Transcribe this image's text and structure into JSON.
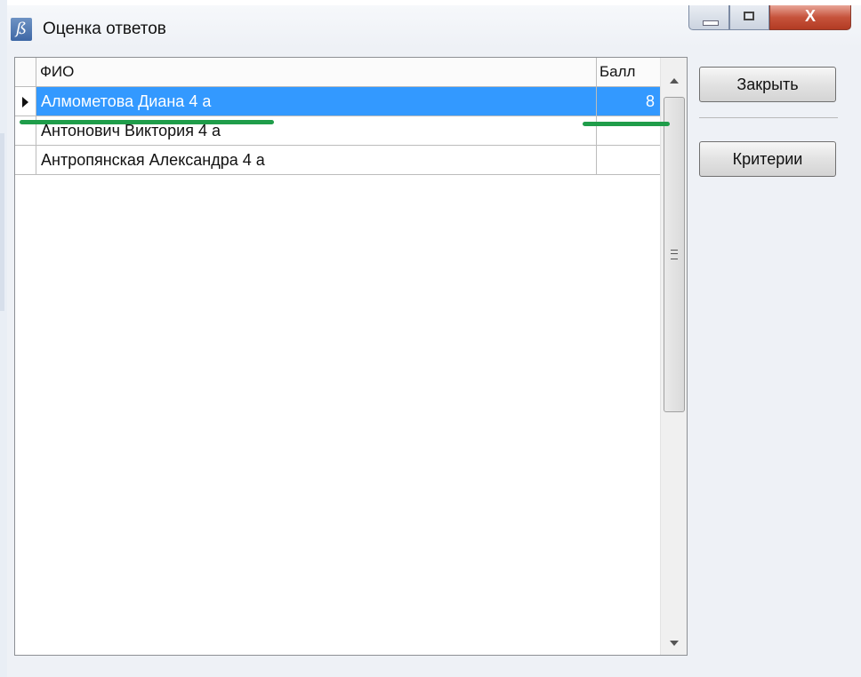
{
  "window": {
    "title": "Оценка ответов",
    "icon": "app-logo-icon",
    "controls": {
      "minimize": "minimize-icon",
      "maximize": "maximize-icon",
      "close_glyph": "X"
    }
  },
  "grid": {
    "columns": {
      "fio": "ФИО",
      "ball": "Балл"
    },
    "rows": [
      {
        "fio": "Алмометова Диана 4 а",
        "ball": "8",
        "selected": true
      },
      {
        "fio": "Антонович Виктория 4 а",
        "ball": "",
        "selected": false
      },
      {
        "fio": "Антропянская Александра 4 а",
        "ball": "",
        "selected": false
      }
    ]
  },
  "buttons": {
    "close": "Закрыть",
    "criteria": "Критерии"
  },
  "colors": {
    "selection": "#3399ff",
    "annotation": "#1f9d4a"
  }
}
